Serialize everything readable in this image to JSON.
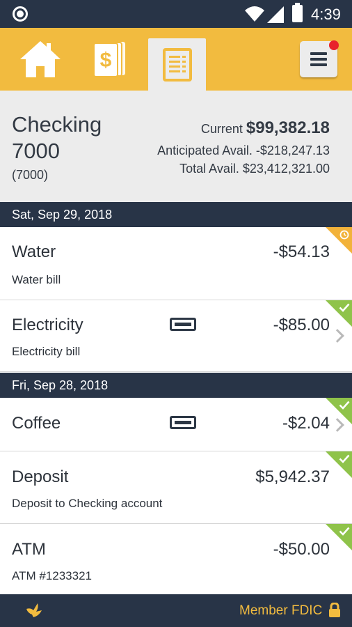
{
  "status_bar": {
    "time": "4:39"
  },
  "nav": {
    "tabs": [
      {
        "name": "home",
        "icon": "home-icon"
      },
      {
        "name": "payments",
        "icon": "dollar-bill-icon"
      },
      {
        "name": "transactions",
        "icon": "document-list-icon",
        "active": true
      }
    ],
    "menu_icon": "hamburger-menu-icon",
    "has_notification": true,
    "accent_color": "#f2bb3f"
  },
  "account": {
    "name": "Checking 7000",
    "number": "(7000)",
    "current_label": "Current ",
    "current_value": "$99,382.18",
    "anticipated": "Anticipated Avail. -$218,247.13",
    "total": "Total Avail. $23,412,321.00"
  },
  "groups": [
    {
      "date": "Sat, Sep 29, 2018",
      "transactions": [
        {
          "name": "Water",
          "amount": "-$54.13",
          "description": "Water bill",
          "status": "pending"
        },
        {
          "name": "Electricity",
          "amount": "-$85.00",
          "description": "Electricity bill",
          "status": "cleared",
          "card": true,
          "chevron": true
        }
      ]
    },
    {
      "date": "Fri, Sep 28, 2018",
      "transactions": [
        {
          "name": "Coffee",
          "amount": "-$2.04",
          "description": "",
          "status": "cleared",
          "card": true,
          "chevron": true
        },
        {
          "name": "Deposit",
          "amount": "$5,942.37",
          "description": "Deposit to Checking account",
          "status": "cleared"
        },
        {
          "name": "ATM",
          "amount": "-$50.00",
          "description": "ATM #1233321",
          "status": "cleared"
        }
      ]
    }
  ],
  "footer": {
    "fdic": "Member FDIC",
    "logo_icon": "bird-logo-icon",
    "lock_icon": "lock-icon"
  },
  "colors": {
    "dark": "#283447",
    "cleared": "#8fc34a",
    "pending": "#f2b23a"
  }
}
